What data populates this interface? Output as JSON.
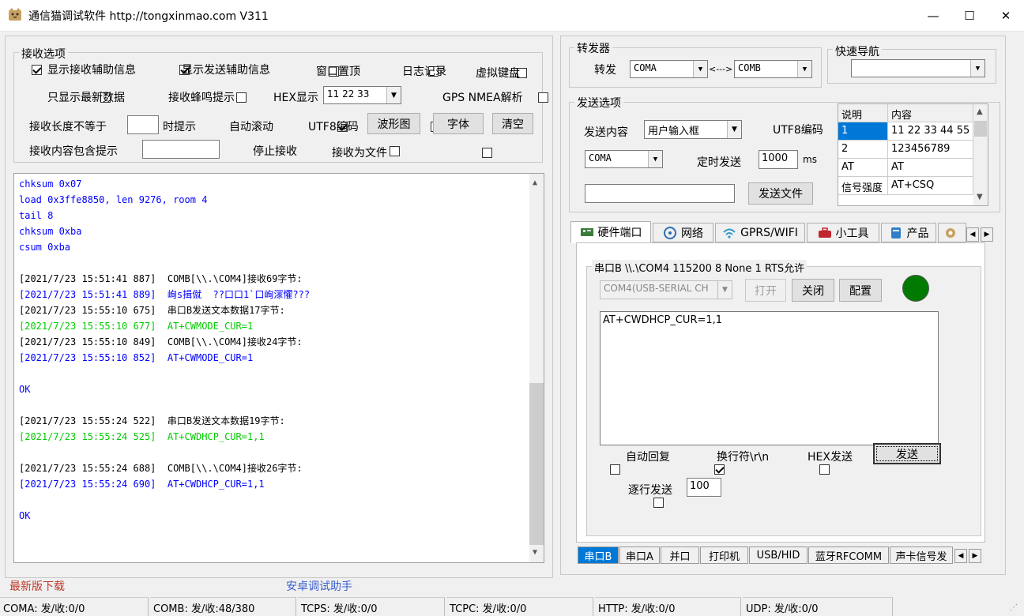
{
  "window": {
    "title": "通信猫调试软件  http://tongxinmao.com  V311",
    "controls": [
      "—",
      "☐",
      "✕"
    ]
  },
  "receive_options": {
    "group_label": "接收选项",
    "show_rx_info": "显示接收辅助信息",
    "show_tx_info": "显示发送辅助信息",
    "stay_top": "窗口置顶",
    "log_record": "日志记录",
    "virtual_keyboard": "虚拟键盘",
    "only_latest": "只显示最新数据",
    "rx_beep": "接收蜂鸣提示",
    "hex_display": "HEX显示",
    "hex_value": "11 22 33",
    "gps_parse": "GPS NMEA解析",
    "len_not_equal": "接收长度不等于",
    "len_hint": "时提示",
    "auto_scroll": "自动滚动",
    "utf8": "UTF8编码",
    "waveform_btn": "波形图",
    "font_btn": "字体",
    "clear_btn": "清空",
    "contains_hint": "接收内容包含提示",
    "stop_rx": "停止接收",
    "rx_to_file": "接收为文件"
  },
  "log_lines": [
    {
      "text": "chksum 0x07",
      "color": "#0000ff"
    },
    {
      "text": "load 0x3ffe8850, len 9276, room 4",
      "color": "#0000ff"
    },
    {
      "text": "tail 8",
      "color": "#0000ff"
    },
    {
      "text": "chksum 0xba",
      "color": "#0000ff"
    },
    {
      "text": "csum 0xba",
      "color": "#0000ff"
    },
    {
      "text": "",
      "color": "#000000"
    },
    {
      "text": "[2021/7/23 15:51:41 887]  COMB[\\\\.\\COM4]接收69字节:",
      "color": "#000000"
    },
    {
      "text": "[2021/7/23 15:51:41 889]  峋s揖僦  ??口口1`口峋溕懼???",
      "color": "#0000ff"
    },
    {
      "text": "[2021/7/23 15:55:10 675]  串口B发送文本数据17字节:",
      "color": "#000000"
    },
    {
      "text": "[2021/7/23 15:55:10 677]  AT+CWMODE_CUR=1",
      "color": "#00cc00"
    },
    {
      "text": "[2021/7/23 15:55:10 849]  COMB[\\\\.\\COM4]接收24字节:",
      "color": "#000000"
    },
    {
      "text": "[2021/7/23 15:55:10 852]  AT+CWMODE_CUR=1",
      "color": "#0000ff"
    },
    {
      "text": "",
      "color": "#000000"
    },
    {
      "text": "OK",
      "color": "#0000ff"
    },
    {
      "text": "",
      "color": "#000000"
    },
    {
      "text": "[2021/7/23 15:55:24 522]  串口B发送文本数据19字节:",
      "color": "#000000"
    },
    {
      "text": "[2021/7/23 15:55:24 525]  AT+CWDHCP_CUR=1,1",
      "color": "#00cc00"
    },
    {
      "text": "",
      "color": "#000000"
    },
    {
      "text": "[2021/7/23 15:55:24 688]  COMB[\\\\.\\COM4]接收26字节:",
      "color": "#000000"
    },
    {
      "text": "[2021/7/23 15:55:24 690]  AT+CWDHCP_CUR=1,1",
      "color": "#0000ff"
    },
    {
      "text": "",
      "color": "#000000"
    },
    {
      "text": "OK",
      "color": "#0000ff"
    }
  ],
  "bottom_links": {
    "latest": "最新版下载",
    "android": "安卓调试助手"
  },
  "forwarder": {
    "group_label": "转发器",
    "forward": "转发",
    "from": "COMA",
    "arrow": "<--->",
    "to": "COMB"
  },
  "quick_nav": {
    "group_label": "快速导航",
    "value": ""
  },
  "send_options": {
    "group_label": "发送选项",
    "content_label": "发送内容",
    "content_value": "用户输入框",
    "utf8": "UTF8编码",
    "port": "COMA",
    "timed_send": "定时发送",
    "interval": "1000",
    "unit": "ms",
    "input_value": "",
    "send_file": "发送文件"
  },
  "command_table": {
    "headers": [
      "说明",
      "内容"
    ],
    "rows": [
      [
        "1",
        "11 22 33 44 55"
      ],
      [
        "2",
        "123456789"
      ],
      [
        "AT",
        "AT"
      ],
      [
        "信号强度",
        "AT+CSQ"
      ]
    ]
  },
  "top_tabs": [
    {
      "label": "硬件端口",
      "icon": "board-icon"
    },
    {
      "label": "网络",
      "icon": "network-icon"
    },
    {
      "label": "GPRS/WIFI",
      "icon": "wifi-icon"
    },
    {
      "label": "小工具",
      "icon": "toolbox-icon"
    },
    {
      "label": "产品",
      "icon": "product-icon"
    },
    {
      "label": "",
      "icon": "settings-icon"
    }
  ],
  "serial_b": {
    "group_label": "串口B \\\\.\\COM4  115200  8  None  1  RTS允许",
    "port_value": "COM4(USB-SERIAL CH",
    "open": "打开",
    "close": "关闭",
    "config": "配置",
    "status_color": "#007a00",
    "text": "AT+CWDHCP_CUR=1,1",
    "auto_reply": "自动回复",
    "newline": "换行符\\r\\n",
    "hex_send": "HEX发送",
    "send": "发送",
    "line_send": "逐行发送",
    "line_value": "100"
  },
  "bottom_tabs": [
    "串口B",
    "串口A",
    "并口",
    "打印机",
    "USB/HID",
    "蓝牙RFCOMM",
    "声卡信号发"
  ],
  "status_bar": [
    "COMA: 发/收:0/0",
    "COMB: 发/收:48/380",
    "TCPS: 发/收:0/0",
    "TCPC: 发/收:0/0",
    "HTTP: 发/收:0/0",
    "UDP: 发/收:0/0"
  ]
}
